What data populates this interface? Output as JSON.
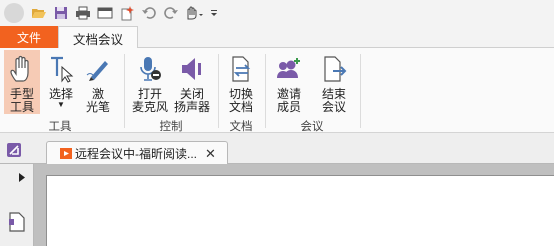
{
  "tabs": {
    "file": "文件",
    "active": "文档会议"
  },
  "groups": {
    "tools": "工具",
    "control": "控制",
    "document": "文档",
    "meeting": "会议"
  },
  "buttons": {
    "hand": [
      "手型",
      "工具"
    ],
    "select": [
      "选择"
    ],
    "laser": [
      "激",
      "光笔"
    ],
    "mic": [
      "打开",
      "麦克风"
    ],
    "speaker": [
      "关闭",
      "扬声器"
    ],
    "switch_doc": [
      "切换",
      "文档"
    ],
    "invite": [
      "邀请",
      "成员"
    ],
    "end": [
      "结束",
      "会议"
    ]
  },
  "document_tab": {
    "title": "远程会议中-福昕阅读...",
    "close": "✕"
  },
  "icons": {
    "app": "foxit-logo-icon",
    "open": "folder-open-icon",
    "save": "save-icon",
    "print": "print-icon",
    "hand": "hand-icon"
  },
  "colors": {
    "accent": "#f2621f",
    "active_button": "#f6cbb5",
    "icon_blue": "#4a78b4",
    "icon_purple": "#7a5aa8"
  }
}
